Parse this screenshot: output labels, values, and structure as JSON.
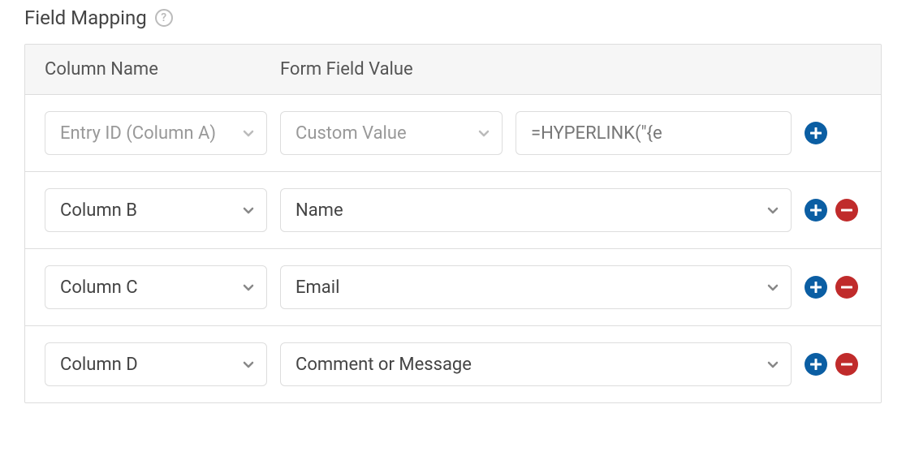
{
  "section": {
    "title": "Field Mapping"
  },
  "headers": {
    "column_name": "Column Name",
    "form_field_value": "Form Field Value"
  },
  "rows": [
    {
      "column": "Entry ID (Column A)",
      "field": "Custom Value",
      "custom_value": "=HYPERLINK(\"{e",
      "disabled": true,
      "has_remove": false
    },
    {
      "column": "Column B",
      "field": "Name",
      "disabled": false,
      "has_remove": true
    },
    {
      "column": "Column C",
      "field": "Email",
      "disabled": false,
      "has_remove": true
    },
    {
      "column": "Column D",
      "field": "Comment or Message",
      "disabled": false,
      "has_remove": true
    }
  ],
  "colors": {
    "add": "#0b5ea3",
    "remove": "#c02b2b",
    "chevron": "#888",
    "chevron_disabled": "#bbb"
  }
}
